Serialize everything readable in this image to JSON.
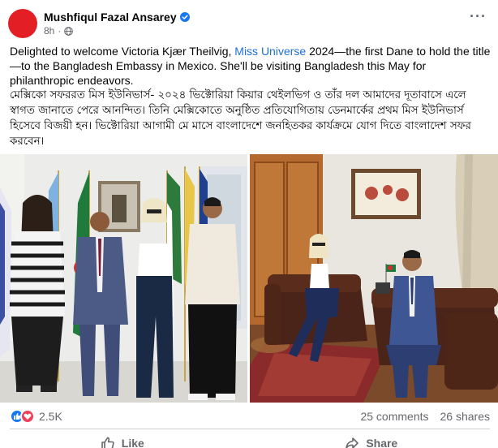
{
  "post": {
    "author": "Mushfiqul Fazal Ansarey",
    "time": "8h",
    "more_label": "···",
    "caption": {
      "en_before": "Delighted to welcome Victoria Kjær Theilvig, ",
      "en_link": "Miss Universe",
      "en_after": " 2024—the first Dane to hold the title—to the Bangladesh Embassy in Mexico. She'll be visiting Bangladesh this May for philanthropic endeavors.",
      "bn": "মেক্সিকো সফররত মিস ইউনিভার্স- ২০২৪ ভিক্টোরিয়া কিয়ার থেইলভিগ ও তাঁর দল আমাদের দূতাবাসে এলে স্বাগত জানাতে পেরে আনন্দিত। তিনি মেক্সিকোতে অনুষ্ঠিত প্রতিযোগিতায় ডেনমার্কের প্রথম মিস ইউনিভার্স হিসেবে বিজয়ী হন। ভিক্টোরিয়া আগামী মে মাসে বাংলাদেশে জনহিতকর কার্যক্রমে যোগ দিতে বাংলাদেশ সফর করবেন।"
    },
    "stats": {
      "reactions": "2.5K",
      "comments": "25 comments",
      "shares": "26 shares"
    },
    "actions": {
      "like": "Like",
      "share": "Share"
    }
  },
  "colors": {
    "avatar": "#e41e25",
    "link": "#216fdb",
    "verified": "#1877f2",
    "muted_text": "#65676b"
  }
}
